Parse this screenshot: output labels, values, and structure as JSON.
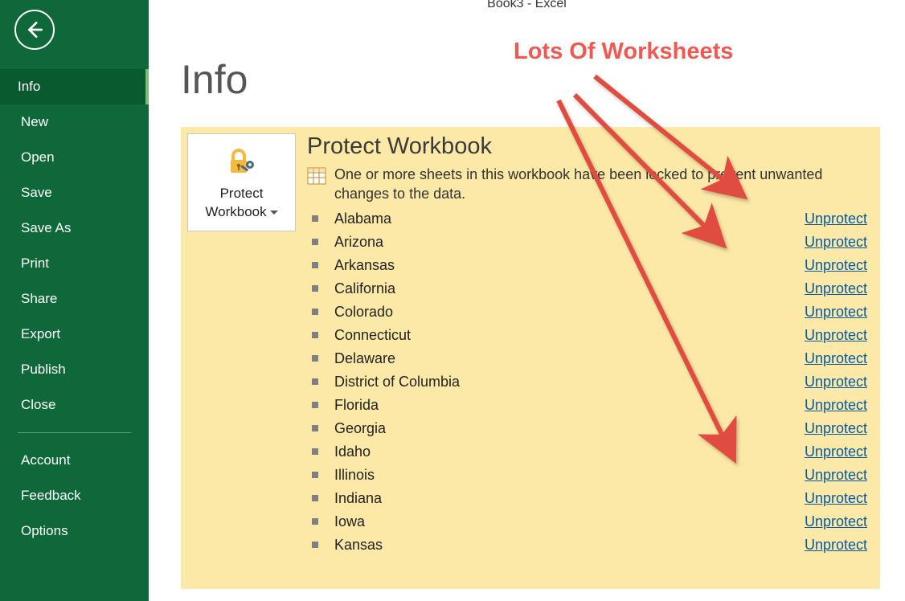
{
  "titlebar": "Book3 - Excel",
  "page_title": "Info",
  "nav": {
    "items": [
      "Info",
      "New",
      "Open",
      "Save",
      "Save As",
      "Print",
      "Share",
      "Export",
      "Publish",
      "Close"
    ],
    "footer_items": [
      "Account",
      "Feedback",
      "Options"
    ],
    "active": "Info"
  },
  "protect": {
    "button_line1": "Protect",
    "button_line2": "Workbook",
    "heading": "Protect Workbook",
    "description": "One or more sheets in this workbook have been locked to prevent unwanted changes to the data.",
    "unprotect_label": "Unprotect",
    "sheets": [
      "Alabama",
      "Arizona",
      "Arkansas",
      "California",
      "Colorado",
      "Connecticut",
      "Delaware",
      "District of Columbia",
      "Florida",
      "Georgia",
      "Idaho",
      "Illinois",
      "Indiana",
      "Iowa",
      "Kansas"
    ]
  },
  "annotation": "Lots Of Worksheets"
}
